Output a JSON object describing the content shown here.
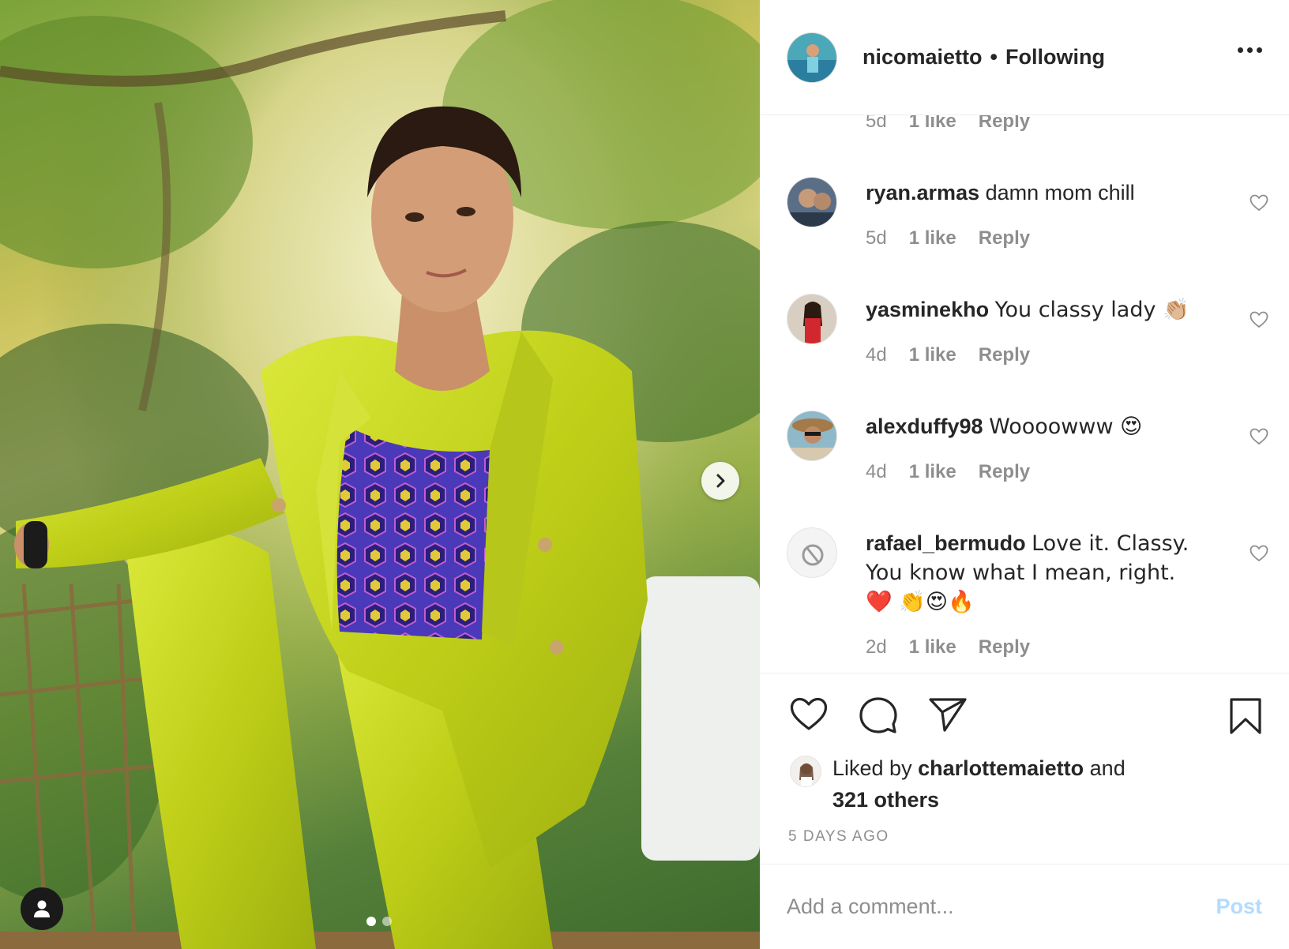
{
  "header": {
    "username": "nicomaietto",
    "separator": "•",
    "follow_status": "Following"
  },
  "comments": [
    {
      "partial": true,
      "time": "5d",
      "likes": "1 like",
      "reply": "Reply"
    },
    {
      "username": "ryan.armas",
      "text": "damn mom chill",
      "time": "5d",
      "likes": "1 like",
      "reply": "Reply"
    },
    {
      "username": "yasminekho",
      "text": "You classy lady 👏🏼",
      "time": "4d",
      "likes": "1 like",
      "reply": "Reply"
    },
    {
      "username": "alexduffy98",
      "text": "Woooowww 😍",
      "time": "4d",
      "likes": "1 like",
      "reply": "Reply"
    },
    {
      "username": "rafael_bermudo",
      "text": "Love it. Classy. You know what I mean, right. ❤️ 👏😍🔥",
      "time": "2d",
      "likes": "1 like",
      "reply": "Reply"
    }
  ],
  "likes": {
    "prefix": "Liked by",
    "liked_user": "charlottemaietto",
    "conjunction": "and",
    "others": "321 others"
  },
  "post_date": "5 DAYS AGO",
  "comment_box": {
    "placeholder": "Add a comment...",
    "post_label": "Post"
  },
  "carousel": {
    "total_slides": 2,
    "active_slide": 1
  },
  "icons": {
    "next": "chevron-right-icon",
    "user_tag": "user-icon",
    "like": "heart-icon",
    "comment": "comment-bubble-icon",
    "share": "paper-plane-icon",
    "save": "bookmark-icon",
    "more": "more-options-icon"
  },
  "colors": {
    "text": "#262626",
    "muted": "#8e8e8e",
    "post_button_disabled": "#b3dbff",
    "divider": "#efefef",
    "suit": "#c9d81e",
    "top": "#4b3bb5"
  }
}
